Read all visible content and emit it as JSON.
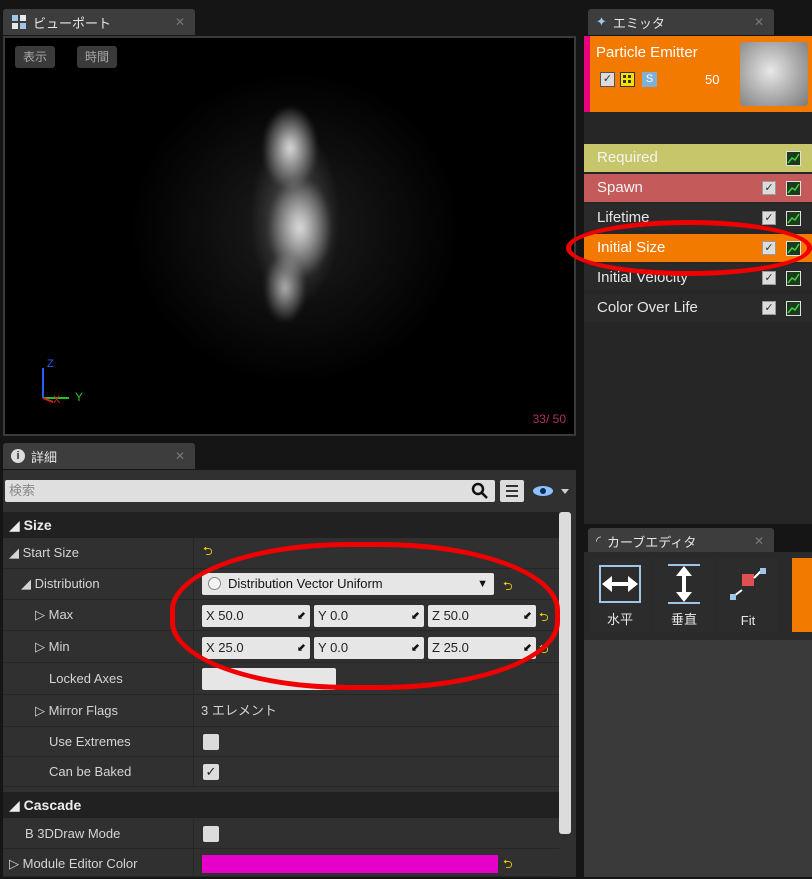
{
  "viewport": {
    "tab_label": "ビューポート",
    "btn_show": "表示",
    "btn_time": "時間",
    "counter": "33/ 50",
    "axis_z": "Z",
    "axis_x": "X",
    "axis_y": "Y"
  },
  "emitter": {
    "tab_label": "エミッタ",
    "name": "Particle Emitter",
    "count": "50",
    "solo_label": "S",
    "modules": [
      {
        "label": "Required"
      },
      {
        "label": "Spawn"
      },
      {
        "label": "Lifetime"
      },
      {
        "label": "Initial Size"
      },
      {
        "label": "Initial Velocity"
      },
      {
        "label": "Color Over Life"
      }
    ]
  },
  "details": {
    "tab_label": "詳細",
    "search_placeholder": "検索",
    "categories": {
      "size": "Size",
      "cascade": "Cascade"
    },
    "start_size": "Start Size",
    "distribution_label": "Distribution",
    "distribution_value": "Distribution Vector Uniform",
    "max_label": "Max",
    "max": {
      "x": "50.0",
      "y": "0.0",
      "z": "50.0"
    },
    "min_label": "Min",
    "min": {
      "x": "25.0",
      "y": "0.0",
      "z": "25.0"
    },
    "axis_x": "X",
    "axis_y": "Y",
    "axis_z": "Z",
    "locked_axes": "Locked Axes",
    "mirror_flags": "Mirror Flags",
    "mirror_value": "3 エレメント",
    "use_extremes": "Use Extremes",
    "can_be_baked": "Can be Baked",
    "b3d_draw_mode": "B 3DDraw Mode",
    "module_editor_color": "Module Editor Color",
    "module_color_hex": "#e600c8"
  },
  "curve_editor": {
    "tab_label": "カーブエディタ",
    "tools": [
      {
        "label": "水平"
      },
      {
        "label": "垂直"
      },
      {
        "label": "Fit"
      }
    ]
  },
  "colors": {
    "accent_orange": "#f27a00",
    "required_yellow": "#c7c66a",
    "spawn_red": "#c45a5a",
    "annotation_red": "#f00000"
  }
}
